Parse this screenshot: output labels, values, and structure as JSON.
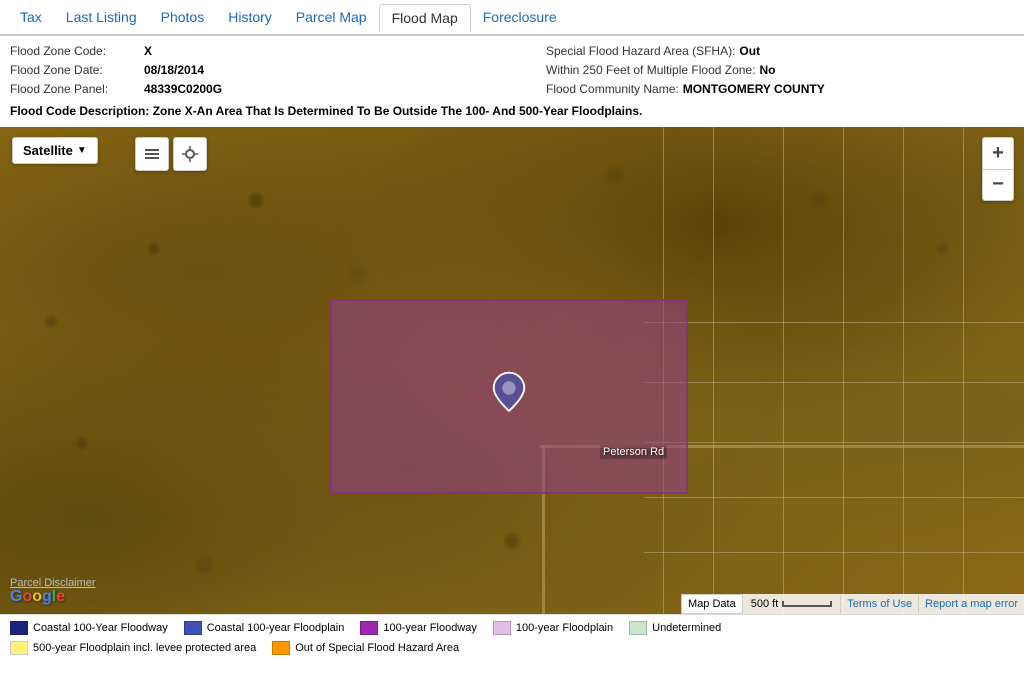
{
  "nav": {
    "tabs": [
      {
        "label": "Tax",
        "active": false
      },
      {
        "label": "Last Listing",
        "active": false
      },
      {
        "label": "Photos",
        "active": false
      },
      {
        "label": "History",
        "active": false
      },
      {
        "label": "Parcel Map",
        "active": false
      },
      {
        "label": "Flood Map",
        "active": true
      },
      {
        "label": "Foreclosure",
        "active": false
      }
    ]
  },
  "info": {
    "flood_zone_code_label": "Flood Zone Code:",
    "flood_zone_code_value": "X",
    "flood_zone_date_label": "Flood Zone Date:",
    "flood_zone_date_value": "08/18/2014",
    "flood_zone_panel_label": "Flood Zone Panel:",
    "flood_zone_panel_value": "48339C0200G",
    "flood_code_description_label": "Flood Code Description:",
    "flood_code_description_value": "Zone X-An Area That Is Determined To Be Outside The 100- And 500-Year Floodplains.",
    "sfha_label": "Special Flood Hazard Area (SFHA):",
    "sfha_value": "Out",
    "multiple_flood_zone_label": "Within 250 Feet of Multiple Flood Zone:",
    "multiple_flood_zone_value": "No",
    "flood_community_label": "Flood Community Name:",
    "flood_community_value": "MONTGOMERY COUNTY"
  },
  "map": {
    "satellite_btn": "Satellite",
    "zoom_in": "+",
    "zoom_out": "−",
    "peterson_rd": "Peterson Rd",
    "parcel_disclaimer": "Parcel Disclaimer",
    "google_logo": "Google",
    "map_data_btn": "Map Data",
    "scale_label": "500 ft",
    "terms_link": "Terms of Use",
    "report_link": "Report a map error"
  },
  "legend": {
    "rows": [
      [
        {
          "color": "#1a237e",
          "label": "Coastal 100-Year Floodway"
        },
        {
          "color": "#3f51b5",
          "label": "Coastal 100-year Floodplain"
        },
        {
          "color": "#9c27b0",
          "label": "100-year Floodway"
        },
        {
          "color": "#e1bee7",
          "label": "100-year Floodplain"
        },
        {
          "color": "#c8e6c9",
          "label": "Undetermined"
        }
      ],
      [
        {
          "color": "#fff176",
          "label": "500-year Floodplain incl. levee protected area"
        },
        {
          "color": "#ff9800",
          "label": "Out of Special Flood Hazard Area"
        }
      ]
    ]
  }
}
